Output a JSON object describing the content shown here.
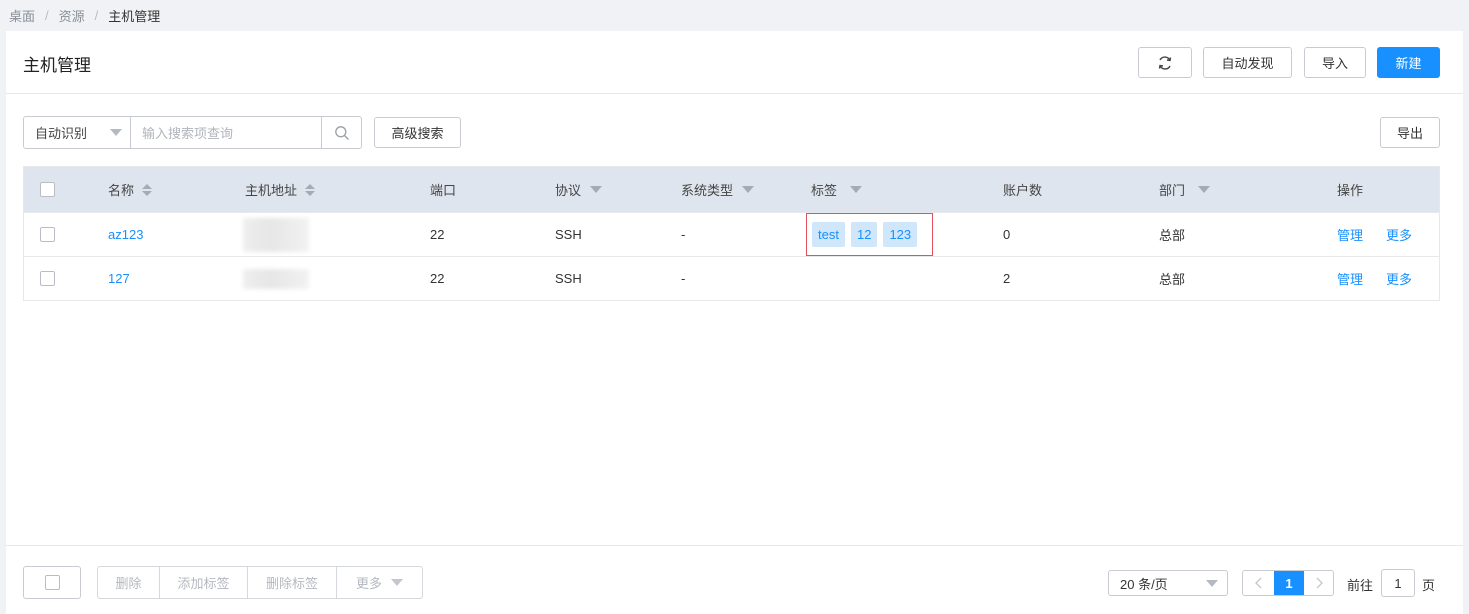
{
  "breadcrumb": {
    "items": [
      "桌面",
      "资源",
      "主机管理"
    ],
    "separator": "/"
  },
  "page": {
    "title": "主机管理"
  },
  "toolbar": {
    "auto_discover": "自动发现",
    "import": "导入",
    "create": "新建",
    "export": "导出",
    "refresh_icon": "refresh-icon"
  },
  "search": {
    "scope": "自动识别",
    "placeholder": "输入搜索项查询",
    "advanced": "高级搜索"
  },
  "table": {
    "headers": {
      "name": "名称",
      "address": "主机地址",
      "port": "端口",
      "protocol": "协议",
      "os_type": "系统类型",
      "tags": "标签",
      "accounts": "账户数",
      "department": "部门",
      "actions": "操作"
    },
    "rows": [
      {
        "name": "az123",
        "port": "22",
        "protocol": "SSH",
        "os_type": "-",
        "tags": [
          "test",
          "12",
          "123"
        ],
        "accounts": "0",
        "department": "总部",
        "manage": "管理",
        "more": "更多"
      },
      {
        "name": "127",
        "port": "22",
        "protocol": "SSH",
        "os_type": "-",
        "tags": [],
        "accounts": "2",
        "department": "总部",
        "manage": "管理",
        "more": "更多"
      }
    ]
  },
  "footer": {
    "delete": "删除",
    "add_tag": "添加标签",
    "remove_tag": "删除标签",
    "more": "更多",
    "page_size": "20 条/页",
    "current_page": "1",
    "goto_label": "前往",
    "goto_value": "1",
    "page_unit": "页"
  },
  "colors": {
    "primary": "#1890ff",
    "highlight_border": "#e0525e",
    "tag_bg": "#cfe6fb"
  }
}
